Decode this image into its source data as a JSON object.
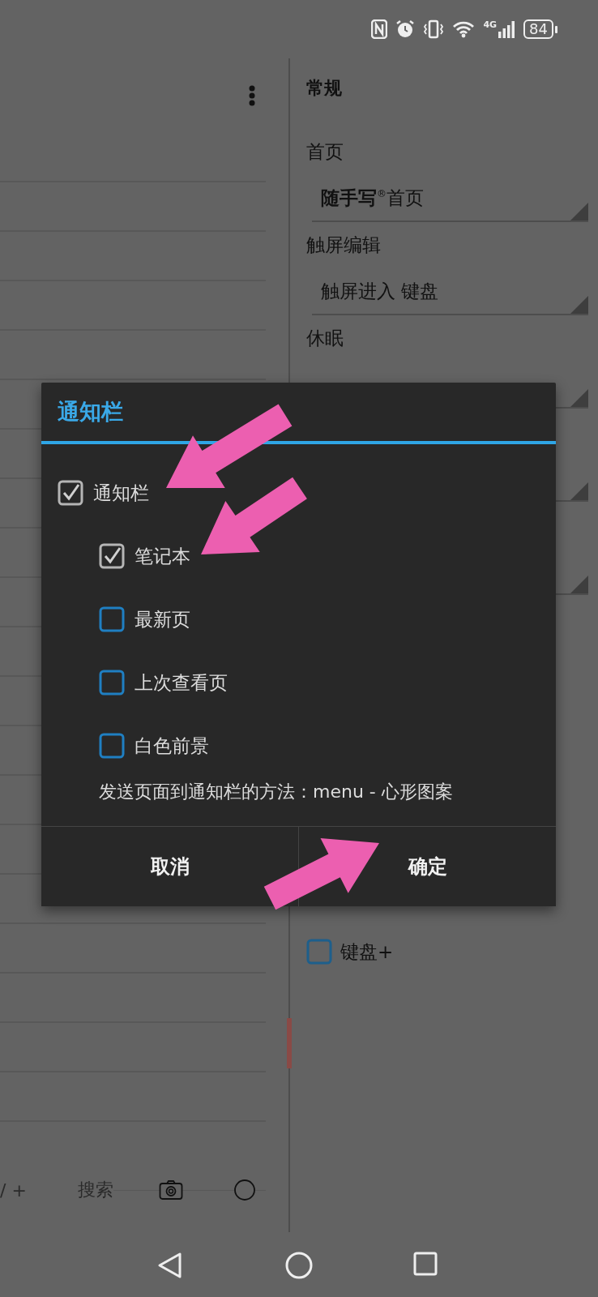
{
  "status_bar": {
    "network": "4G",
    "battery": "84"
  },
  "notes_pane": {
    "toolbar": {
      "partial_label": "/ +",
      "search": "搜索"
    }
  },
  "settings": {
    "section": "常规",
    "items": [
      {
        "kind": "dropdown",
        "label": "首页",
        "value": "**随手写**$^{®}$首页"
      },
      {
        "kind": "dropdown",
        "label": "触屏编辑",
        "value": "触屏进入 键盘"
      },
      {
        "kind": "dropdown",
        "label": "休眠"
      },
      {
        "kind": "covered_dropdown"
      },
      {
        "kind": "covered_dropdown"
      },
      {
        "kind": "checkbox",
        "label": "键盘+",
        "checked": false
      }
    ]
  },
  "dialog": {
    "title": "通知栏",
    "options": [
      {
        "label": "通知栏",
        "checked": true,
        "children": [
          {
            "label": "笔记本",
            "checked": true
          },
          {
            "label": "最新页",
            "checked": false
          },
          {
            "label": "上次查看页",
            "checked": false
          },
          {
            "label": "白色前景",
            "checked": false
          }
        ]
      }
    ],
    "note": "发送页面到通知栏的方法：menu - 心形图案",
    "buttons": [
      "取消",
      "确定"
    ]
  }
}
